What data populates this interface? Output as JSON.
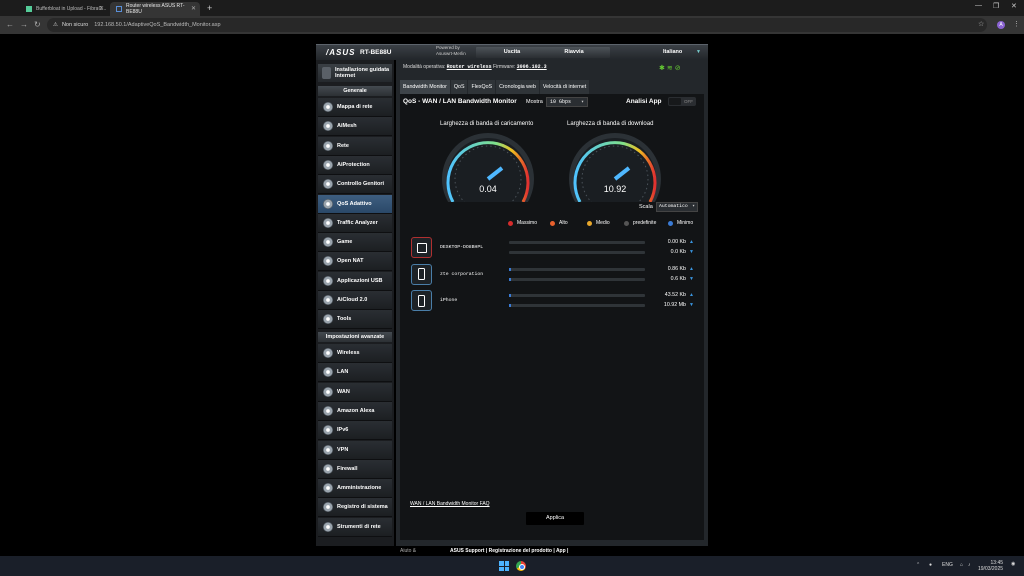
{
  "browser": {
    "tabs": [
      {
        "label": "Bufferbloat in Upload - FibraC...",
        "active": false
      },
      {
        "label": "Router wireless ASUS RT-BE88U",
        "active": true
      }
    ],
    "security_label": "Non sicuro",
    "url": "192.168.50.1/AdaptiveQoS_Bandwidth_Monitor.asp",
    "profile_initial": "A"
  },
  "router": {
    "brand": "/ASUS",
    "model": "RT-BE88U",
    "powered_by": "Powered by",
    "powered_name": "Asuswrt-Merlin",
    "logout": "Uscita",
    "reboot": "Riavvia",
    "language": "Italiano",
    "op_mode_label": "Modalità operativa:",
    "op_mode_value": "Router wireless",
    "firmware_label": "Firmware:",
    "firmware_value": "3006.102.3"
  },
  "sidebar": {
    "install": "Installazione guidata Internet",
    "general_header": "Generale",
    "general_items": [
      "Mappa di rete",
      "AiMesh",
      "Rete",
      "AiProtection",
      "Controllo Genitori",
      "QoS Adattivo",
      "Traffic Analyzer",
      "Game",
      "Open NAT",
      "Applicazioni USB",
      "AiCloud 2.0",
      "Tools"
    ],
    "active_item": "QoS Adattivo",
    "advanced_header": "Impostazioni avanzate",
    "advanced_items": [
      "Wireless",
      "LAN",
      "WAN",
      "Amazon Alexa",
      "IPv6",
      "VPN",
      "Firewall",
      "Amministrazione",
      "Registro di sistema",
      "Strumenti di rete"
    ]
  },
  "tabs": [
    "Bandwidth Monitor",
    "QoS",
    "FlexQoS",
    "Cronologia web",
    "Velocità di internet"
  ],
  "panel": {
    "title": "QoS - WAN / LAN Bandwidth Monitor",
    "show_label": "Mostra",
    "show_value": "10 Gbps",
    "app_analysis": "Analisi App",
    "toggle_state": "OFF",
    "upload_title": "Larghezza di banda di caricamento",
    "download_title": "Larghezza di banda di download",
    "upload_value": "0.04",
    "download_value": "10.92",
    "scale_label": "Scala",
    "scale_value": "Automatico",
    "legend": [
      {
        "label": "Massimo",
        "color": "#d62c2c"
      },
      {
        "label": "Alto",
        "color": "#e8602c"
      },
      {
        "label": "Medio",
        "color": "#e8a82c"
      },
      {
        "label": "predefinite",
        "color": "#555555"
      },
      {
        "label": "Minimo",
        "color": "#3a7bd5"
      }
    ],
    "devices": [
      {
        "name": "DESKTOP-DO8BHPL",
        "up": "0.00 Kb",
        "down": "0.0 Kb",
        "up_fill": 0,
        "down_fill": 0,
        "icon": "monitor-icon"
      },
      {
        "name": "zte corporation",
        "up": "0.86 Kb",
        "down": "0.6 Kb",
        "up_fill": 0.01,
        "down_fill": 0.01,
        "icon": "phone-icon"
      },
      {
        "name": "iPhone",
        "up": "43.52 Kb",
        "down": "10.92 Mb",
        "up_fill": 0.01,
        "down_fill": 0.01,
        "icon": "phone-icon"
      }
    ],
    "faq": "WAN / LAN Bandwidth Monitor FAQ",
    "apply": "Applica"
  },
  "footer": {
    "left": "Aiuto &",
    "links": "ASUS Support | Registrazione del prodotto | App |"
  },
  "taskbar": {
    "lang": "ENG",
    "time": "13:45",
    "date": "19/03/2025"
  }
}
